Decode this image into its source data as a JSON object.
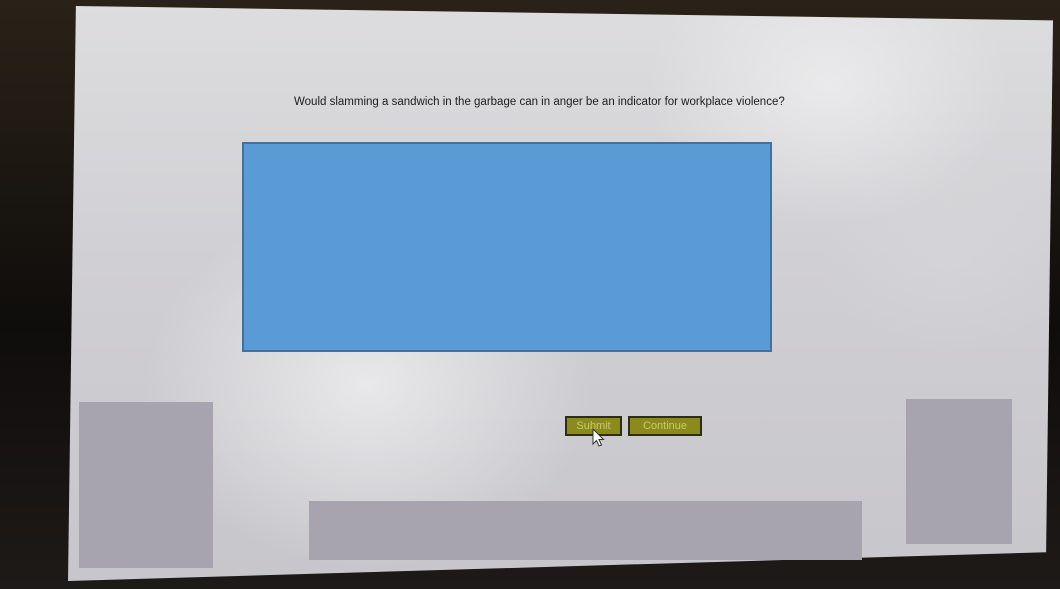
{
  "question": {
    "text": "Would slamming a sandwich in the garbage can in anger be an indicator for workplace violence?"
  },
  "buttons": {
    "submit_label": "Submit",
    "continue_label": "Continue"
  },
  "colors": {
    "answer_area": "#5b9bd5",
    "button_fill": "#8a8a1f",
    "button_text": "#c9c96a"
  }
}
